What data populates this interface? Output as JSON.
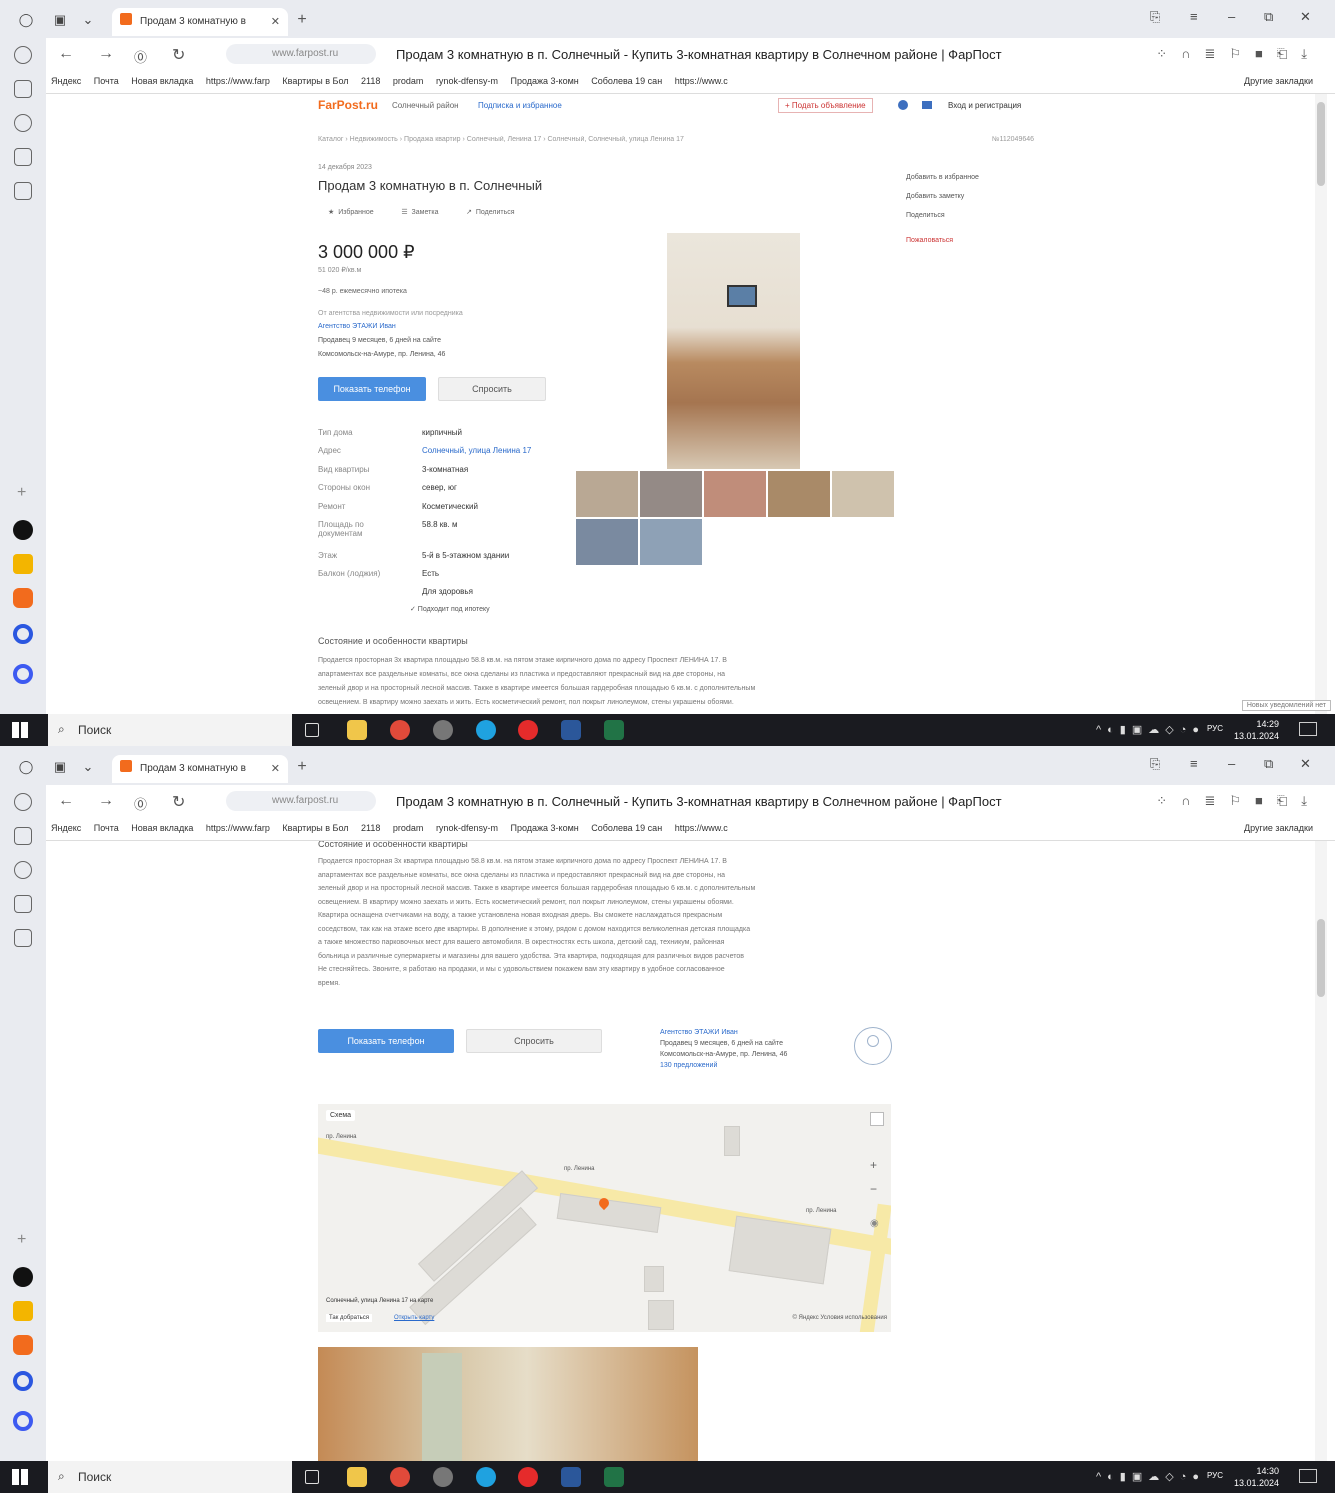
{
  "browser": {
    "tab_title": "Продам 3 комнатную в",
    "url": "www.farpost.ru",
    "page_title": "Продам 3 комнатную в п. Солнечный - Купить 3-комнатная квартиру в Солнечном районе | ФарПост",
    "bookmarks": [
      "Яндекс",
      "Почта",
      "Новая вкладка",
      "https://www.farp",
      "Квартиры в Бол",
      "2118",
      "prodam",
      "rynok-dfensy-m",
      "Продажа 3-комн",
      "Соболева 19 сан",
      "https://www.c"
    ],
    "other_bookmarks": "Другие закладки"
  },
  "site": {
    "logo": "FarPost.ru",
    "region": "Солнечный район",
    "nav_link": "Подписка и избранное",
    "post_ad": "+ Подать объявление",
    "login": "Вход и регистрация"
  },
  "listing": {
    "breadcrumb": "Каталог › Недвижимость › Продажа квартир › Солнечный, Ленина 17 › Солнечный, Солнечный, улица Ленина 17",
    "ad_id": "№112049646",
    "date": "14 декабря 2023",
    "title": "Продам 3 комнатную в п. Солнечный",
    "actions": [
      "★ Избранное",
      "☰ Заметка",
      "↗ Поделиться"
    ],
    "price": "3 000 000 ₽",
    "price_per_m2": "51 020 ₽/кв.м",
    "mortgage": "~48 р. ежемесячно ипотека",
    "agency_note": "От агентства недвижимости или посредника",
    "agency": "Агентство ЭТАЖИ Иван",
    "seller_stats": "Продавец 9 месяцев, 6 дней на сайте",
    "seller_address": "Комсомольск-на-Амуре, пр. Ленина, 46",
    "show_phone": "Показать телефон",
    "ask": "Спросить",
    "side_actions": [
      "Добавить в избранное",
      "Добавить заметку",
      "Поделиться"
    ],
    "complain": "Пожаловаться",
    "params": [
      {
        "label": "Тип дома",
        "value": "кирпичный"
      },
      {
        "label": "Адрес",
        "value": "Солнечный, улица Ленина 17"
      },
      {
        "label": "Вид квартиры",
        "value": "3-комнатная"
      },
      {
        "label": "Стороны окон",
        "value": "север, юг"
      },
      {
        "label": "Ремонт",
        "value": "Косметический"
      },
      {
        "label": "Площадь по документам",
        "value": "58.8 кв. м"
      },
      {
        "label": "Этаж",
        "value": "5-й в 5-этажном здании"
      },
      {
        "label": "Балкон (лоджия)",
        "value": "Есть"
      },
      {
        "label": "",
        "value": "Для здоровья"
      }
    ],
    "mortgage_ok": "✓ Подходит под ипотеку",
    "desc_title": "Состояние и особенности квартиры",
    "desc_lines": [
      "Продается просторная 3х квартира площадью 58.8 кв.м. на пятом этаже кирпичного дома по адресу Проспект ЛЕНИНА 17. В",
      "апартаментах все раздельные комнаты, все окна сделаны из пластика и предоставляют прекрасный вид на две стороны, на",
      "зеленый двор и на просторный лесной массив. Также в квартире имеется большая гардеробная площадью 6 кв.м. с дополнительным",
      "освещением. В квартиру можно заехать и жить. Есть косметический ремонт, пол покрыт линолеумом, стены украшены обоями.",
      "Квартира оснащена счетчиками на воду, а также установлена новая входная дверь. Вы сможете наслаждаться прекрасным",
      "соседством, так как на этаже всего две квартиры. В дополнение к этому, рядом с домом находится великолепная детская площадка",
      "а также множество парковочных мест для вашего автомобиля. В окрестностях есть школа, детский сад, техникум, районная",
      "больница и различные супермаркеты и магазины для вашего удобства. Эта квартира, подходящая для различных видов расчетов",
      "Не стесняйтесь. Звоните, я работаю на продажи, и мы с удовольствием покажем вам эту квартиру в удобное согласованное",
      "время."
    ],
    "seller_card": {
      "name": "Агентство ЭТАЖИ Иван",
      "stats": "Продавец 9 месяцев, 6 дней на сайте",
      "address": "Комсомольск-на-Амуре, пр. Ленина, 46",
      "ads": "130 предложений"
    },
    "map": {
      "layer": "Схема",
      "streets": [
        "пр. Ленина",
        "пр. Ленина",
        "пр. Ленина"
      ],
      "address": "Солнечный, улица Ленина 17 на карте",
      "route": "Так добраться",
      "open_map": "Открыть карту",
      "attribution": "© Яндекс Условия использования"
    }
  },
  "taskbar": {
    "search": "Поиск",
    "lang": "РУС",
    "time1": "14:29",
    "time2": "14:30",
    "date": "13.01.2024",
    "notification": "Новых уведомлений нет"
  },
  "colors": {
    "accent": "#f26b1d",
    "blue_button": "#4a8fe0",
    "link": "#2a6acb"
  }
}
